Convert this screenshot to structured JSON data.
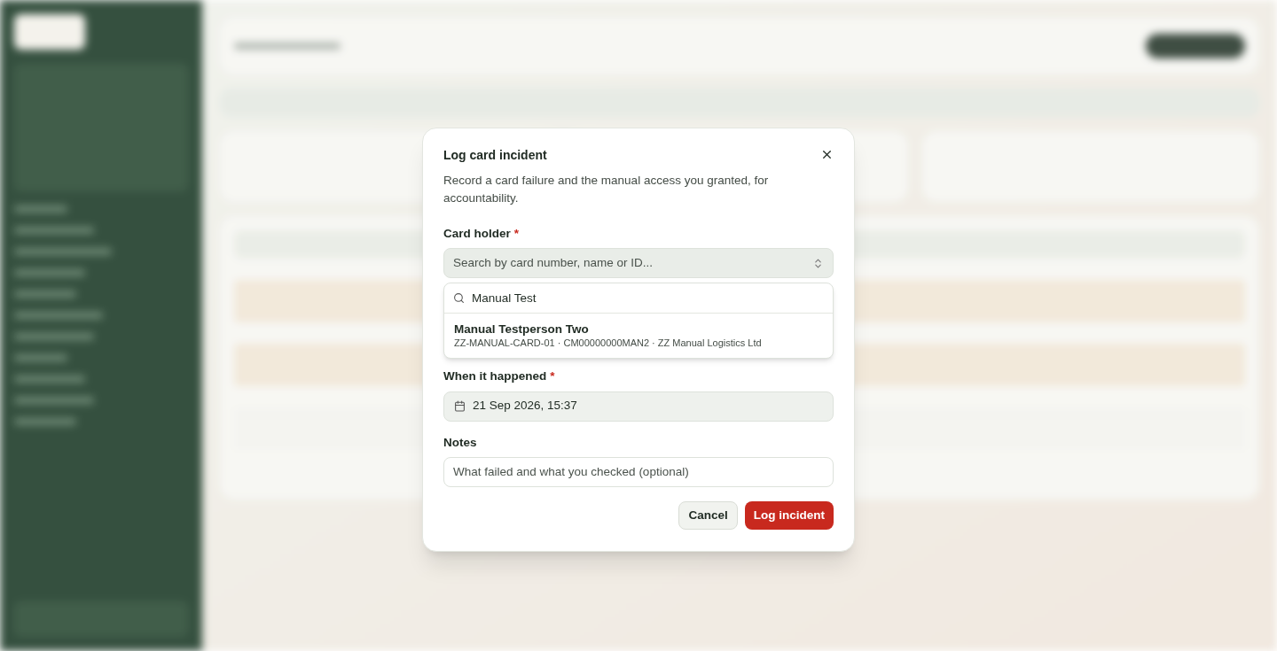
{
  "dialog": {
    "title": "Log card incident",
    "description": "Record a card failure and the manual access you granted, for accountability.",
    "card_holder": {
      "label": "Card holder",
      "required_mark": "*",
      "placeholder": "Search by card number, name or ID...",
      "search_value": "Manual Test",
      "results": [
        {
          "name": "Manual Testperson Two",
          "details": "ZZ-MANUAL-CARD-01 · CM00000000MAN2 · ZZ Manual Logistics Ltd",
          "selected": false
        }
      ]
    },
    "when": {
      "label": "When it happened",
      "required_mark": "*",
      "value": "21 Sep 2026, 15:37"
    },
    "notes": {
      "label": "Notes",
      "placeholder": "What failed and what you checked (optional)"
    },
    "buttons": [
      {
        "kind": "secondary",
        "label": "Cancel"
      },
      {
        "kind": "primary",
        "label": "Log incident"
      }
    ]
  }
}
